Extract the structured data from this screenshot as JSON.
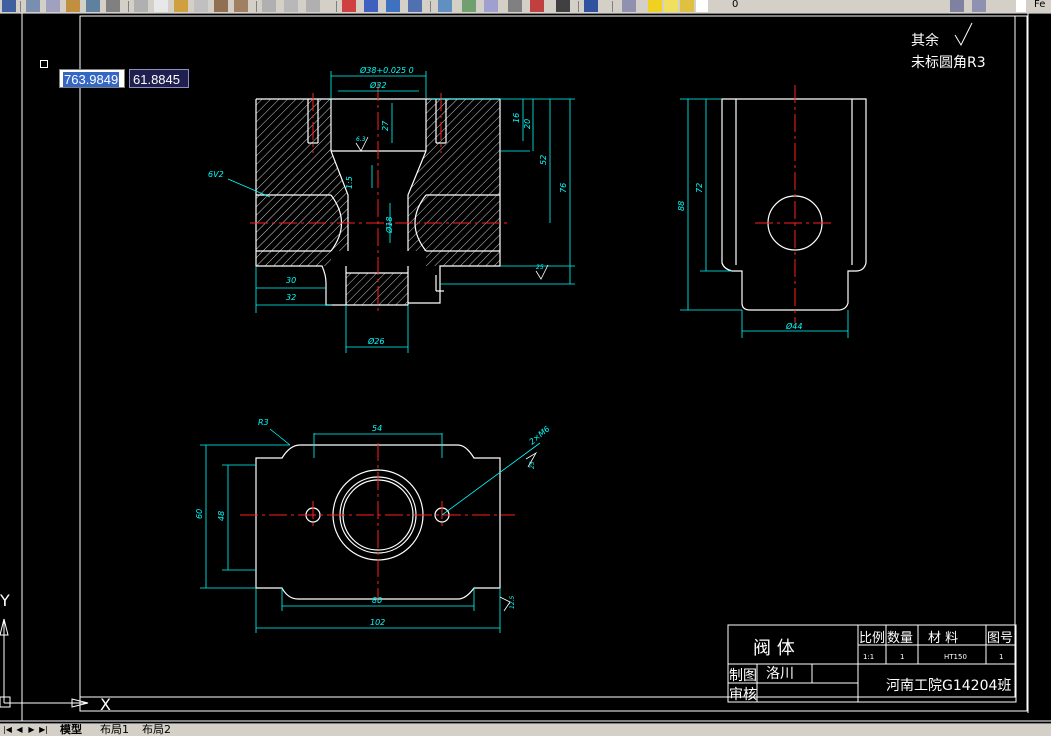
{
  "toolbar": {
    "layer_value": "0",
    "right_text": "Fe"
  },
  "coords": {
    "x": "763.9849",
    "y": "61.8845"
  },
  "ucs": {
    "y_label": "Y",
    "x_label": "X"
  },
  "tabs": [
    "模型",
    "布局1",
    "布局2"
  ],
  "notes": {
    "line1": "其余",
    "line2": "未标圆角R3"
  },
  "title_block": {
    "part_name": "阀    体",
    "headers": {
      "scale": "比例",
      "qty": "数量",
      "material": "材 料",
      "drawing_no": "图号"
    },
    "values": {
      "scale": "1:1",
      "qty": "1",
      "material": "HT150",
      "drawing_no": "1"
    },
    "drawn_label": "制图",
    "drawn_by": "洛川",
    "checked_label": "审核",
    "school": "河南工院G14204班"
  },
  "dimensions": {
    "top_bore": "Ø38+0.025 0",
    "inner_bore": "Ø32",
    "depth_27": "27",
    "depth_16": "16",
    "depth_20": "20",
    "height_52": "52",
    "height_76": "76",
    "thread": "6V2",
    "slope": "1:5",
    "hole_18": "Ø18",
    "rough_63": "6.3",
    "rough_25": "25",
    "len_30": "30",
    "len_32": "32",
    "base_26": "Ø26",
    "side_88": "88",
    "side_72": "72",
    "side_44": "Ø44",
    "width_54": "54",
    "radius_r3": "R3",
    "holes": "2×M6",
    "rough_25b": "25",
    "h_60": "60",
    "h_48": "48",
    "w_80": "80",
    "w_102": "102",
    "rough_125": "12.5"
  }
}
